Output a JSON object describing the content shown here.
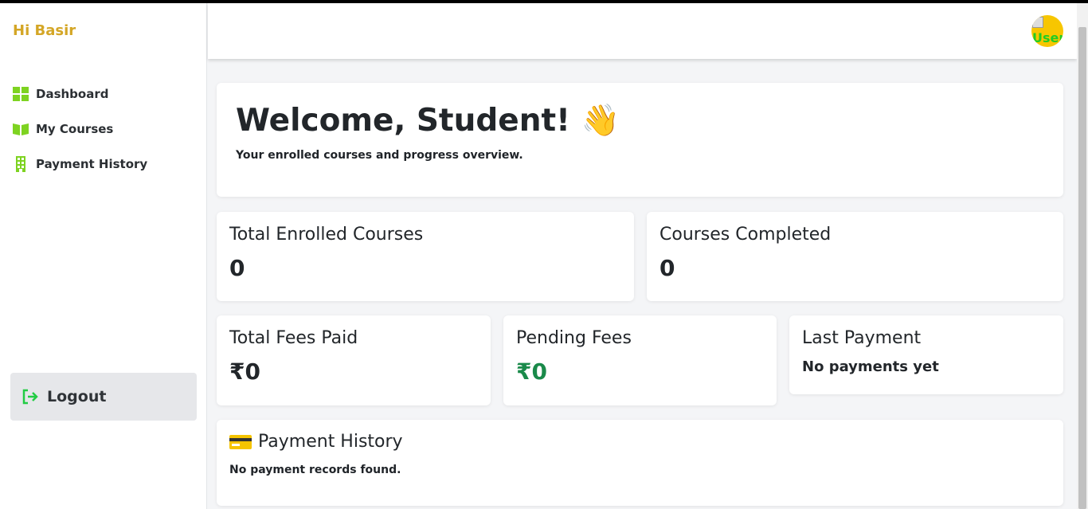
{
  "sidebar": {
    "greeting": "Hi Basir",
    "items": [
      {
        "label": "Dashboard",
        "icon": "dashboard-grid-icon"
      },
      {
        "label": "My Courses",
        "icon": "open-book-icon"
      },
      {
        "label": "Payment History",
        "icon": "building-icon"
      }
    ],
    "logout_label": "Logout",
    "accent_color": "#7ed321"
  },
  "header": {
    "avatar_alt": "User"
  },
  "welcome": {
    "title": "Welcome, Student! 👋",
    "subtitle": "Your enrolled courses and progress overview."
  },
  "stats": {
    "total_enrolled": {
      "label": "Total Enrolled Courses",
      "value": "0"
    },
    "completed": {
      "label": "Courses Completed",
      "value": "0"
    },
    "fees_paid": {
      "label": "Total Fees Paid",
      "value": "₹0"
    },
    "pending_fees": {
      "label": "Pending Fees",
      "value": "₹0",
      "color": "#1a8a4a"
    },
    "last_payment": {
      "label": "Last Payment",
      "value": "No payments yet"
    }
  },
  "payment_history": {
    "title": "Payment History",
    "empty_text": "No payment records found."
  }
}
